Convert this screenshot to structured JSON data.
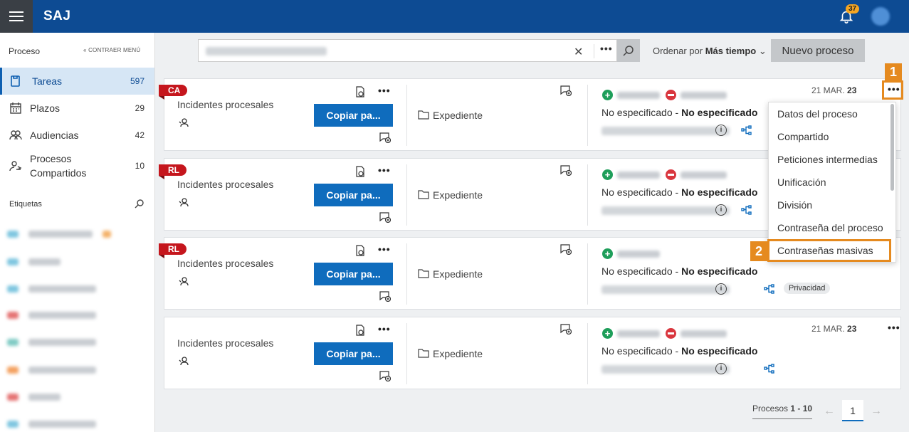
{
  "app": {
    "brand": "SAJ",
    "notifications_count": "37"
  },
  "sidebar": {
    "header": "Proceso",
    "collapse_label": "CONTRAER MENÚ",
    "items": [
      {
        "label": "Tareas",
        "count": "597",
        "icon": "tasks-icon"
      },
      {
        "label": "Plazos",
        "count": "29",
        "icon": "calendar-icon"
      },
      {
        "label": "Audiencias",
        "count": "42",
        "icon": "people-icon"
      },
      {
        "label": "Procesos Compartidos",
        "count": "10",
        "icon": "shared-users-icon"
      }
    ],
    "tags_title": "Etiquetas",
    "tag_colors": [
      "#7fc6e0",
      "#7fc6e0",
      "#7fc6e0",
      "#e57373",
      "#80cbc4",
      "#f4a261",
      "#e57373",
      "#7fc6e0"
    ]
  },
  "toolbar": {
    "sort_prefix": "Ordenar por",
    "sort_value": "Más tiempo",
    "new_process_label": "Nuevo proceso"
  },
  "cards": [
    {
      "tag": "CA",
      "title": "Incidentes procesales",
      "copy_label": "Copiar pa...",
      "expediente": "Expediente",
      "no_especificado_1": "No especificado",
      "no_especificado_2": "No especificado",
      "date_prefix": "21 MAR.",
      "date_year": "23",
      "badge": ""
    },
    {
      "tag": "RL",
      "title": "Incidentes procesales",
      "copy_label": "Copiar pa...",
      "expediente": "Expediente",
      "no_especificado_1": "No especificado",
      "no_especificado_2": "No especificado",
      "date_prefix": "",
      "date_year": "",
      "badge": ""
    },
    {
      "tag": "RL",
      "title": "Incidentes procesales",
      "copy_label": "Copiar pa...",
      "expediente": "Expediente",
      "no_especificado_1": "No especificado",
      "no_especificado_2": "No especificado",
      "date_prefix": "",
      "date_year": "",
      "badge": "Privacidad"
    },
    {
      "tag": "",
      "title": "Incidentes procesales",
      "copy_label": "Copiar pa...",
      "expediente": "Expediente",
      "no_especificado_1": "No especificado",
      "no_especificado_2": "No especificado",
      "date_prefix": "21 MAR.",
      "date_year": "23",
      "badge": ""
    }
  ],
  "dropdown": {
    "items": [
      "Datos del proceso",
      "Compartido",
      "Peticiones intermedias",
      "Unificación",
      "División",
      "Contraseña del proceso",
      "Contraseñas masivas"
    ]
  },
  "callouts": {
    "first": "1",
    "second": "2"
  },
  "pagination": {
    "prefix": "Procesos",
    "range": "1 - 10",
    "current_page": "1"
  },
  "colors": {
    "topbar": "#0d4b93",
    "accent_blue": "#0f6cbd",
    "tag_red": "#c5161d",
    "callout_orange": "#e58a1f"
  }
}
